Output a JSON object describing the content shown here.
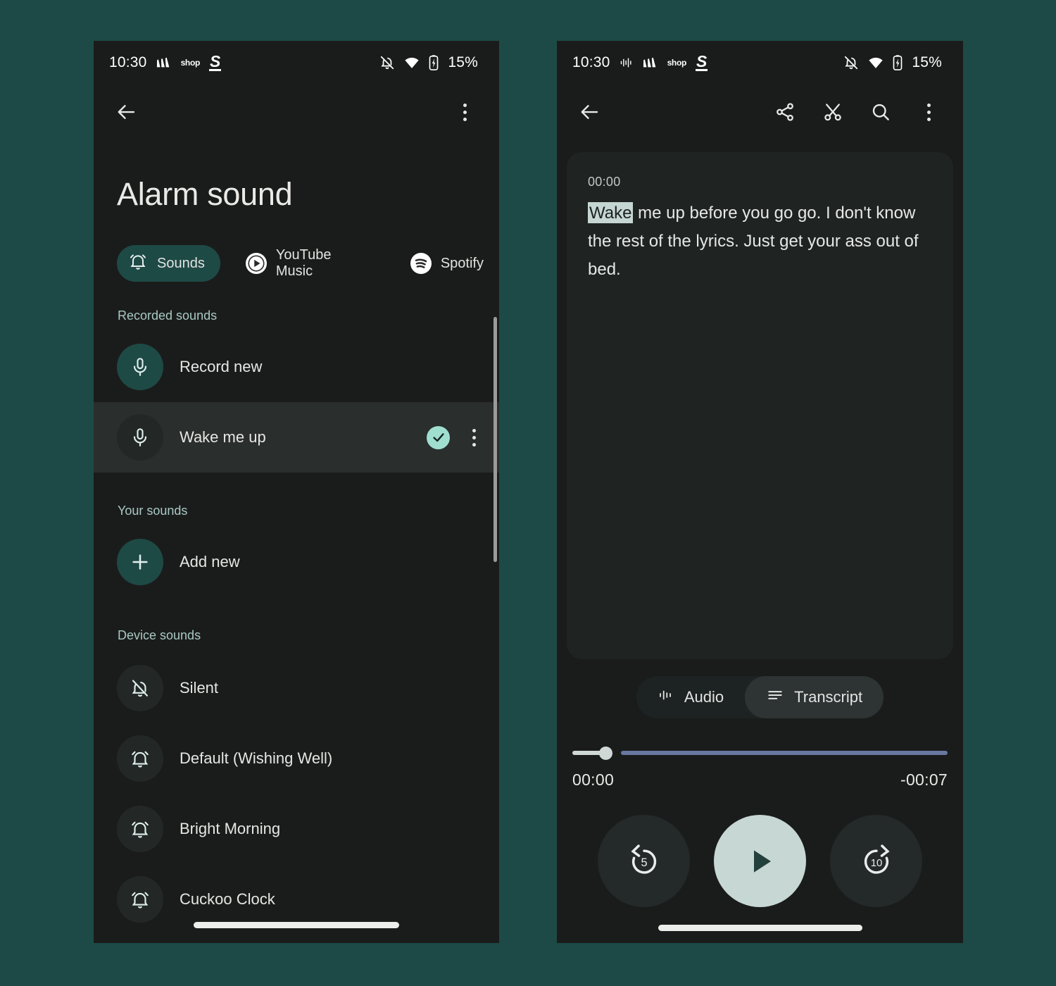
{
  "theme": {
    "page_bg": "#1d4a47",
    "screen_bg": "#1a1c1b",
    "accent_teal": "#1e4a46",
    "accent_mint": "#9fdfd0",
    "card_bg": "#1f2423",
    "seek_rest": "#6878a0",
    "highlight_bg": "#c5d6d3"
  },
  "left_screen": {
    "status_bar": {
      "time": "10:30",
      "battery": "15%",
      "icons": [
        "adidas-logo-icon",
        "shop-icon",
        "s-logo-icon",
        "notifications-off-icon",
        "wifi-icon",
        "battery-charging-icon"
      ],
      "shop_label": "shop",
      "s_label": "S"
    },
    "app_bar": {
      "back": "back-arrow-icon",
      "overflow": "more-vert-icon"
    },
    "title": "Alarm sound",
    "chips": [
      {
        "label": "Sounds",
        "icon": "alarm-bell-icon",
        "selected": true
      },
      {
        "label": "YouTube Music",
        "icon": "youtube-music-icon",
        "selected": false
      },
      {
        "label": "Spotify",
        "icon": "spotify-icon",
        "selected": false
      }
    ],
    "sections": [
      {
        "label": "Recorded sounds",
        "rows": [
          {
            "label": "Record new",
            "icon": "microphone-icon",
            "avatar": "teal",
            "selected": false,
            "has_overflow": false
          },
          {
            "label": "Wake me up",
            "icon": "microphone-icon",
            "avatar": "dim",
            "selected": true,
            "has_overflow": true
          }
        ]
      },
      {
        "label": "Your sounds",
        "rows": [
          {
            "label": "Add new",
            "icon": "plus-icon",
            "avatar": "teal",
            "selected": false,
            "has_overflow": false
          }
        ]
      },
      {
        "label": "Device sounds",
        "rows": [
          {
            "label": "Silent",
            "icon": "bell-off-icon",
            "avatar": "dim",
            "selected": false,
            "has_overflow": false
          },
          {
            "label": "Default (Wishing Well)",
            "icon": "alarm-bell-icon",
            "avatar": "dim",
            "selected": false,
            "has_overflow": false
          },
          {
            "label": "Bright Morning",
            "icon": "alarm-bell-icon",
            "avatar": "dim",
            "selected": false,
            "has_overflow": false
          },
          {
            "label": "Cuckoo Clock",
            "icon": "alarm-bell-icon",
            "avatar": "dim",
            "selected": false,
            "has_overflow": false
          }
        ]
      }
    ]
  },
  "right_screen": {
    "status_bar": {
      "time": "10:30",
      "battery": "15%",
      "icons": [
        "waveform-icon",
        "adidas-logo-icon",
        "shop-icon",
        "s-logo-icon",
        "notifications-off-icon",
        "wifi-icon",
        "battery-charging-icon"
      ],
      "shop_label": "shop",
      "s_label": "S"
    },
    "app_bar": {
      "back": "back-arrow-icon",
      "actions": [
        "share-icon",
        "scissors-trim-icon",
        "search-icon",
        "more-vert-icon"
      ]
    },
    "transcript": {
      "timestamp": "00:00",
      "highlighted_word": "Wake",
      "rest": " me up before you go go. I don't know the rest of the lyrics. Just get your ass out of bed."
    },
    "toggle": [
      {
        "label": "Audio",
        "icon": "waveform-icon",
        "selected": false
      },
      {
        "label": "Transcript",
        "icon": "list-lines-icon",
        "selected": true
      }
    ],
    "player": {
      "elapsed": "00:00",
      "remaining": "-00:07",
      "progress_percent": 4,
      "replay_label": "5",
      "forward_label": "10",
      "play_state": "play"
    }
  }
}
